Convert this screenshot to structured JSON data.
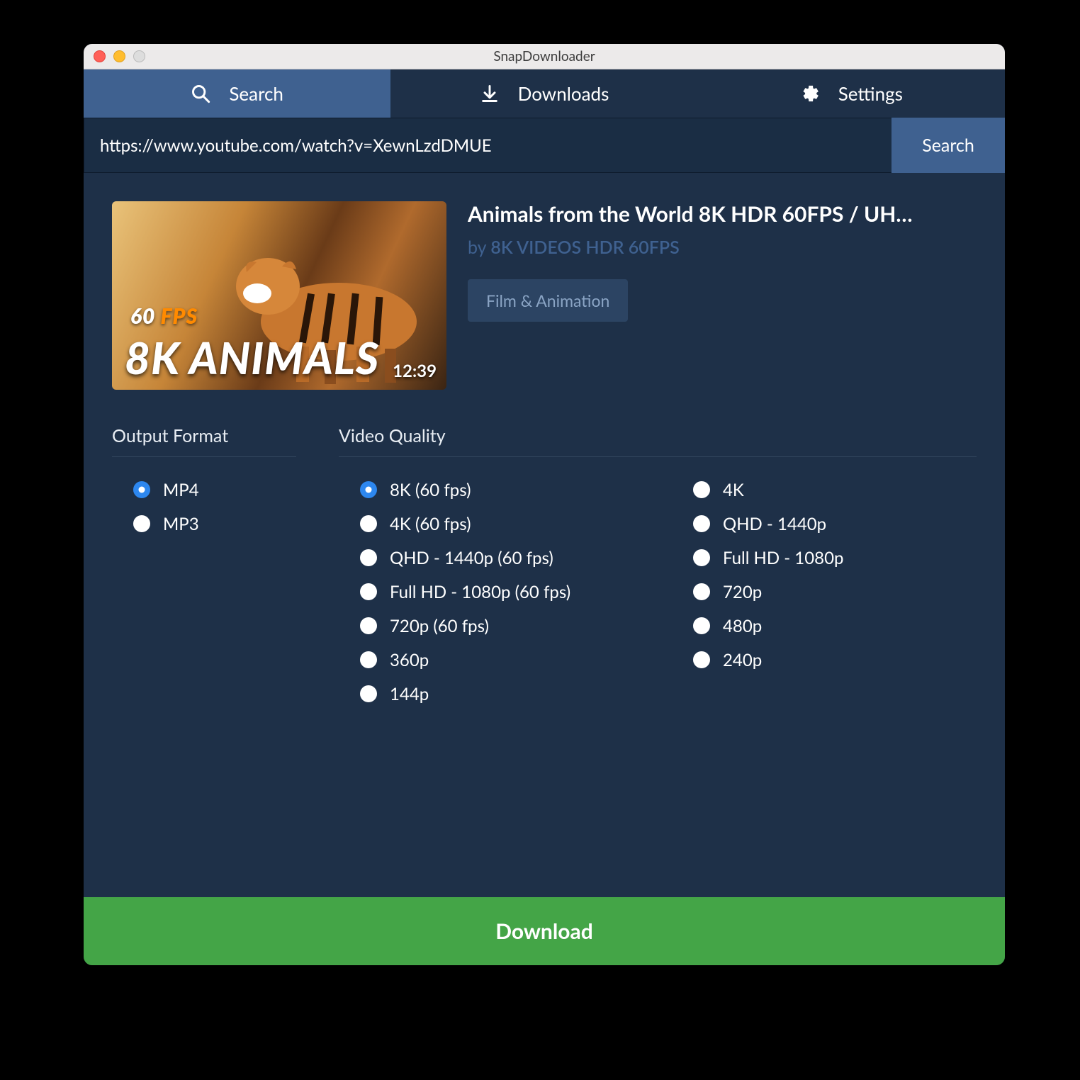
{
  "window": {
    "title": "SnapDownloader"
  },
  "tabs": {
    "search": "Search",
    "downloads": "Downloads",
    "settings": "Settings"
  },
  "search": {
    "url_value": "https://www.youtube.com/watch?v=XewnLzdDMUE",
    "button": "Search"
  },
  "video": {
    "title": "Animals from the World 8K HDR 60FPS / UH…",
    "by_prefix": "by ",
    "channel": "8K VIDEOS HDR 60FPS",
    "category": "Film & Animation",
    "duration": "12:39",
    "thumb_overlay_top_num": "60",
    "thumb_overlay_top_unit": "FPS",
    "thumb_overlay_bottom_a": "8K",
    "thumb_overlay_bottom_b": "ANIMALS"
  },
  "sections": {
    "output_format": "Output Format",
    "video_quality": "Video Quality"
  },
  "formats": [
    {
      "label": "MP4",
      "selected": true
    },
    {
      "label": "MP3",
      "selected": false
    }
  ],
  "qualities_col1": [
    {
      "label": "8K (60 fps)",
      "selected": true
    },
    {
      "label": "4K (60 fps)",
      "selected": false
    },
    {
      "label": "QHD - 1440p (60 fps)",
      "selected": false
    },
    {
      "label": "Full HD - 1080p (60 fps)",
      "selected": false
    },
    {
      "label": "720p (60 fps)",
      "selected": false
    },
    {
      "label": "360p",
      "selected": false
    },
    {
      "label": "144p",
      "selected": false
    }
  ],
  "qualities_col2": [
    {
      "label": "4K",
      "selected": false
    },
    {
      "label": "QHD - 1440p",
      "selected": false
    },
    {
      "label": "Full HD - 1080p",
      "selected": false
    },
    {
      "label": "720p",
      "selected": false
    },
    {
      "label": "480p",
      "selected": false
    },
    {
      "label": "240p",
      "selected": false
    }
  ],
  "download_button": "Download"
}
